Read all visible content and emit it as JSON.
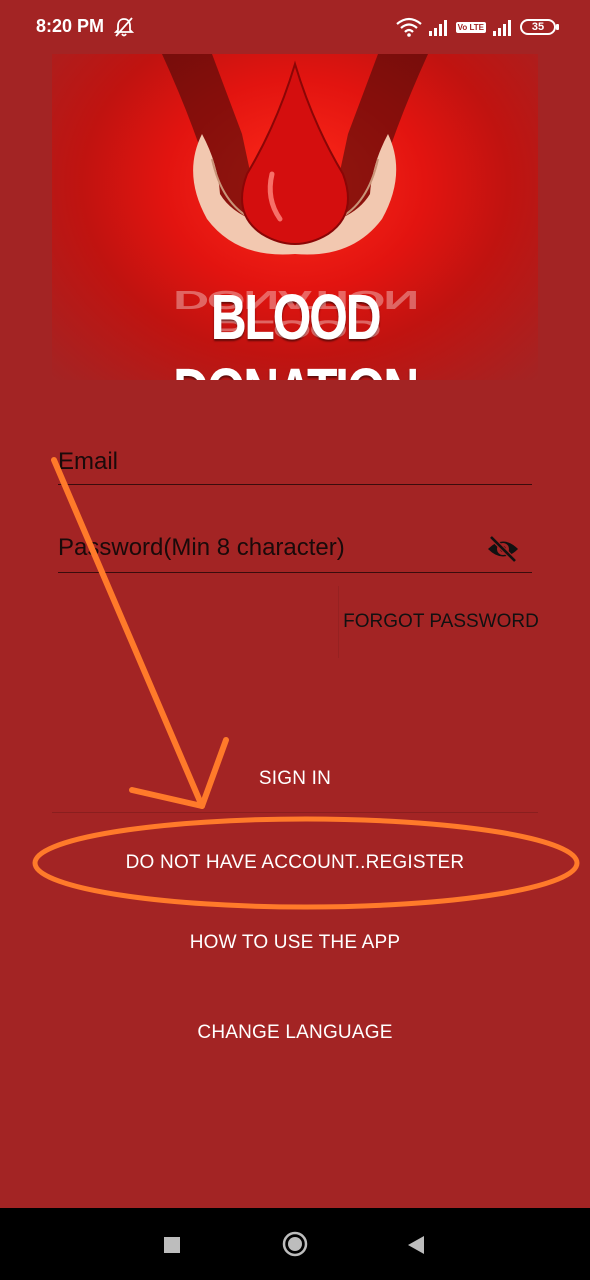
{
  "status_bar": {
    "time": "8:20 PM",
    "battery": "35",
    "volte_label": "Vo LTE"
  },
  "logo": {
    "title": "BLOOD DONATION"
  },
  "form": {
    "email_placeholder": "Email",
    "password_placeholder": "Password(Min 8 character)",
    "forgot_label": "FORGOT PASSWORD"
  },
  "buttons": {
    "sign_in": "SIGN IN",
    "register": "DO NOT HAVE ACCOUNT..REGISTER",
    "how_to": "HOW TO USE THE APP",
    "change_language": "CHANGE LANGUAGE"
  },
  "colors": {
    "background": "#a32424",
    "annotation": "#ff7a2a"
  }
}
